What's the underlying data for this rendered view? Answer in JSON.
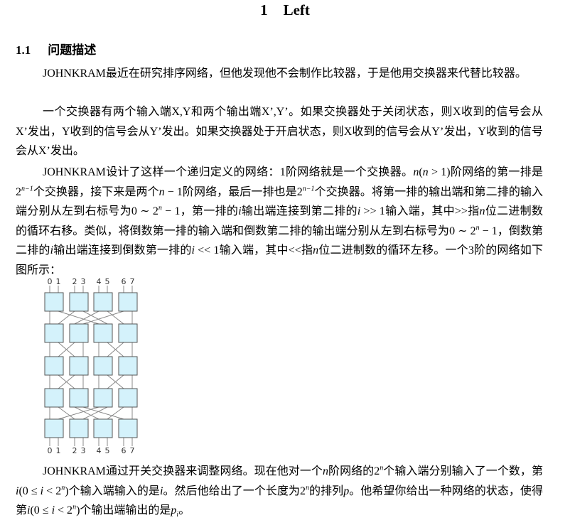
{
  "title": {
    "number": "1",
    "text": "Left"
  },
  "section": {
    "number": "1.1",
    "text": "问题描述"
  },
  "paragraphs": [
    [
      {
        "t": "JOHNKRAM最近在研究排序网络，但他发现他不会制作比较器，于是他用交换器来代替比较器。"
      }
    ],
    [
      {
        "t": "一个交换器有两个输入端X,Y和两个输出端X’,Y’。如果交换器处于关闭状态，则X收到的信号会从X’发出，Y收到的信号会从Y’发出。如果交换器处于开启状态，则X收到的信号会从Y’发出，Y收到的信号会从X’发出。"
      }
    ],
    [
      {
        "t": "JOHNKRAM设计了这样一个递归定义的网络：1阶网络就是一个交换器。"
      },
      {
        "m": "n"
      },
      {
        "t": "("
      },
      {
        "m": "n"
      },
      {
        "t": " > 1)阶网络的第一排是2"
      },
      {
        "s": "n−1"
      },
      {
        "t": "个交换器，接下来是两个"
      },
      {
        "m": "n"
      },
      {
        "t": " − 1阶网络，最后一排也是2"
      },
      {
        "s": "n−1"
      },
      {
        "t": "个交换器。将第一排的输出端和第二排的输入端分别从左到右标号为0 ∼ 2"
      },
      {
        "s": "n"
      },
      {
        "t": " − 1，第一排的"
      },
      {
        "m": "i"
      },
      {
        "t": "输出端连接到第二排的"
      },
      {
        "m": "i"
      },
      {
        "t": " >> 1输入端，其中>>指"
      },
      {
        "m": "n"
      },
      {
        "t": "位二进制数的循环右移。类似，将倒数第一排的输入端和倒数第二排的输出端分别从左到右标号为0 ∼ 2"
      },
      {
        "s": "n"
      },
      {
        "t": " − 1，倒数第二排的"
      },
      {
        "m": "i"
      },
      {
        "t": "输出端连接到倒数第一排的"
      },
      {
        "m": "i"
      },
      {
        "t": " << 1输入端，其中<<指"
      },
      {
        "m": "n"
      },
      {
        "t": "位二进制数的循环左移。一个3阶的网络如下图所示："
      }
    ],
    [
      {
        "t": "JOHNKRAM通过开关交换器来调整网络。现在他对一个"
      },
      {
        "m": "n"
      },
      {
        "t": "阶网络的2"
      },
      {
        "s": "n"
      },
      {
        "t": "个输入端分别输入了一个数，第"
      },
      {
        "m": "i"
      },
      {
        "t": "(0 ≤ "
      },
      {
        "m": "i"
      },
      {
        "t": " < 2"
      },
      {
        "s": "n"
      },
      {
        "t": ")个输入端输入的是"
      },
      {
        "m": "i"
      },
      {
        "t": "。然后他给出了一个长度为2"
      },
      {
        "s": "n"
      },
      {
        "t": "的排列"
      },
      {
        "m": "p"
      },
      {
        "t": "。他希望你给出一种网络的状态，使得第"
      },
      {
        "m": "i"
      },
      {
        "t": "(0 ≤ "
      },
      {
        "m": "i"
      },
      {
        "t": " < 2"
      },
      {
        "s": "n"
      },
      {
        "t": ")个输出端输出的是"
      },
      {
        "m": "p"
      },
      {
        "s": "i",
        "sub": true
      },
      {
        "t": "。"
      }
    ]
  ],
  "figure": {
    "port_labels": [
      "0",
      "1",
      "2",
      "3",
      "4",
      "5",
      "6",
      "7"
    ],
    "order": 3,
    "box_fill": "#d4f2fb",
    "box_stroke": "#555555",
    "wire_color": "#888888"
  }
}
